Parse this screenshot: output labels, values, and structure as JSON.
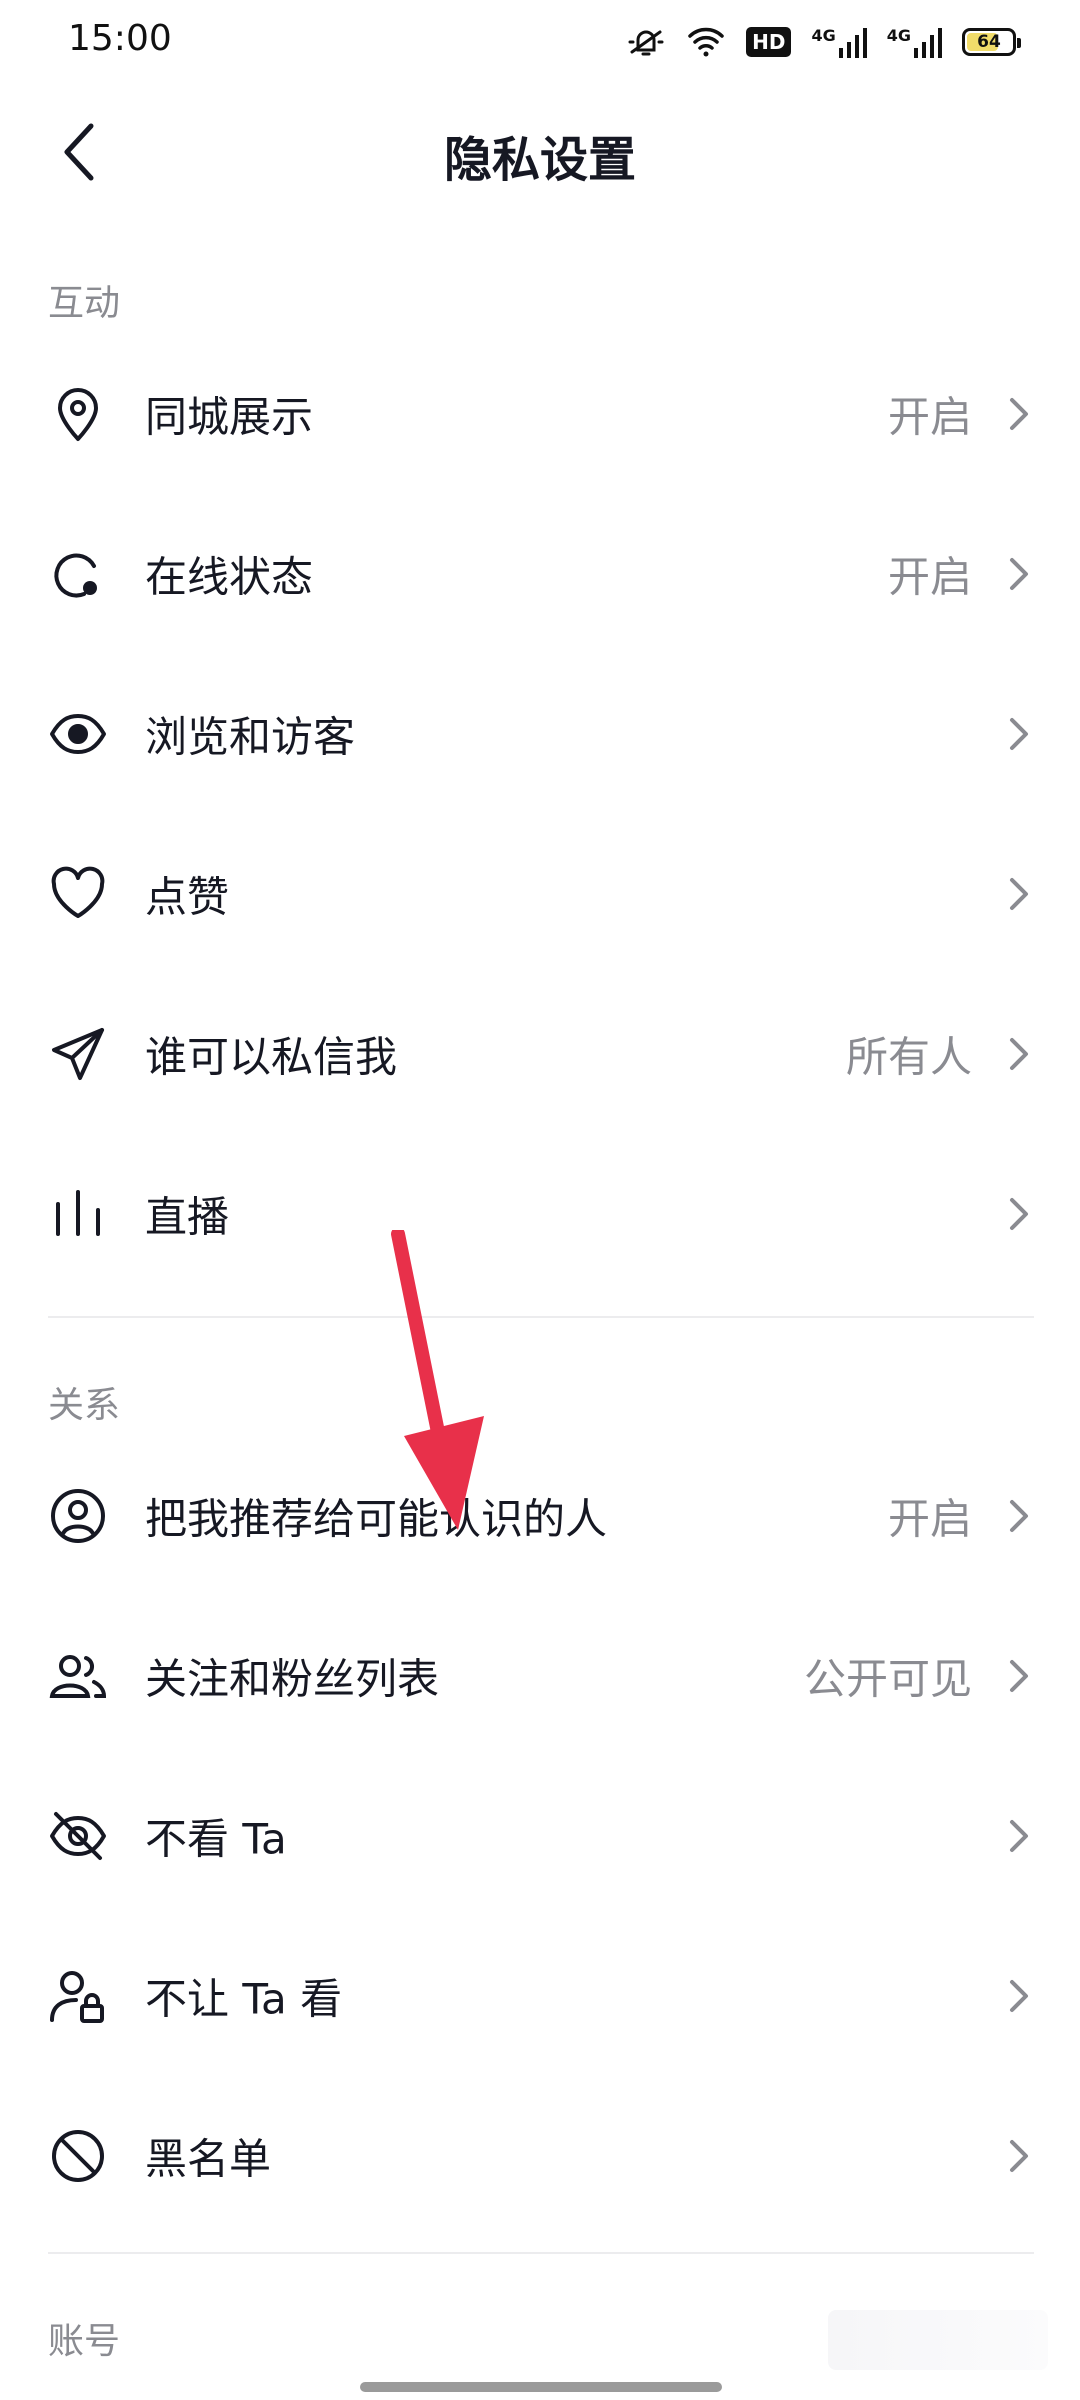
{
  "status_bar": {
    "time": "15:00",
    "hd_label": "HD",
    "net1_label": "4G",
    "net2_label": "4G",
    "battery_level": "64",
    "icons": [
      "mute-icon",
      "wifi-icon",
      "hd-icon",
      "signal-4g-icon",
      "signal-4g-icon",
      "battery-icon"
    ]
  },
  "header": {
    "title": "隐私设置",
    "back_icon": "back-arrow-icon"
  },
  "sections": {
    "interaction": {
      "label": "互动",
      "items": [
        {
          "label": "同城展示",
          "value": "开启",
          "icon": "location-pin-icon"
        },
        {
          "label": "在线状态",
          "value": "开启",
          "icon": "online-status-icon"
        },
        {
          "label": "浏览和访客",
          "value": "",
          "icon": "eye-icon"
        },
        {
          "label": "点赞",
          "value": "",
          "icon": "heart-icon"
        },
        {
          "label": "谁可以私信我",
          "value": "所有人",
          "icon": "send-message-icon"
        },
        {
          "label": "直播",
          "value": "",
          "icon": "live-bars-icon"
        }
      ]
    },
    "relations": {
      "label": "关系",
      "items": [
        {
          "label": "把我推荐给可能认识的人",
          "value": "开启",
          "icon": "user-circle-icon"
        },
        {
          "label": "关注和粉丝列表",
          "value": "公开可见",
          "icon": "users-icon"
        },
        {
          "label": "不看 Ta",
          "value": "",
          "icon": "eye-off-icon"
        },
        {
          "label": "不让 Ta 看",
          "value": "",
          "icon": "user-lock-icon"
        },
        {
          "label": "黑名单",
          "value": "",
          "icon": "block-icon"
        }
      ]
    },
    "account": {
      "label": "账号"
    }
  },
  "colors": {
    "text_primary": "#161823",
    "text_secondary": "#8a8b91",
    "annotation_arrow": "#e8304a",
    "divider": "#ececee"
  }
}
